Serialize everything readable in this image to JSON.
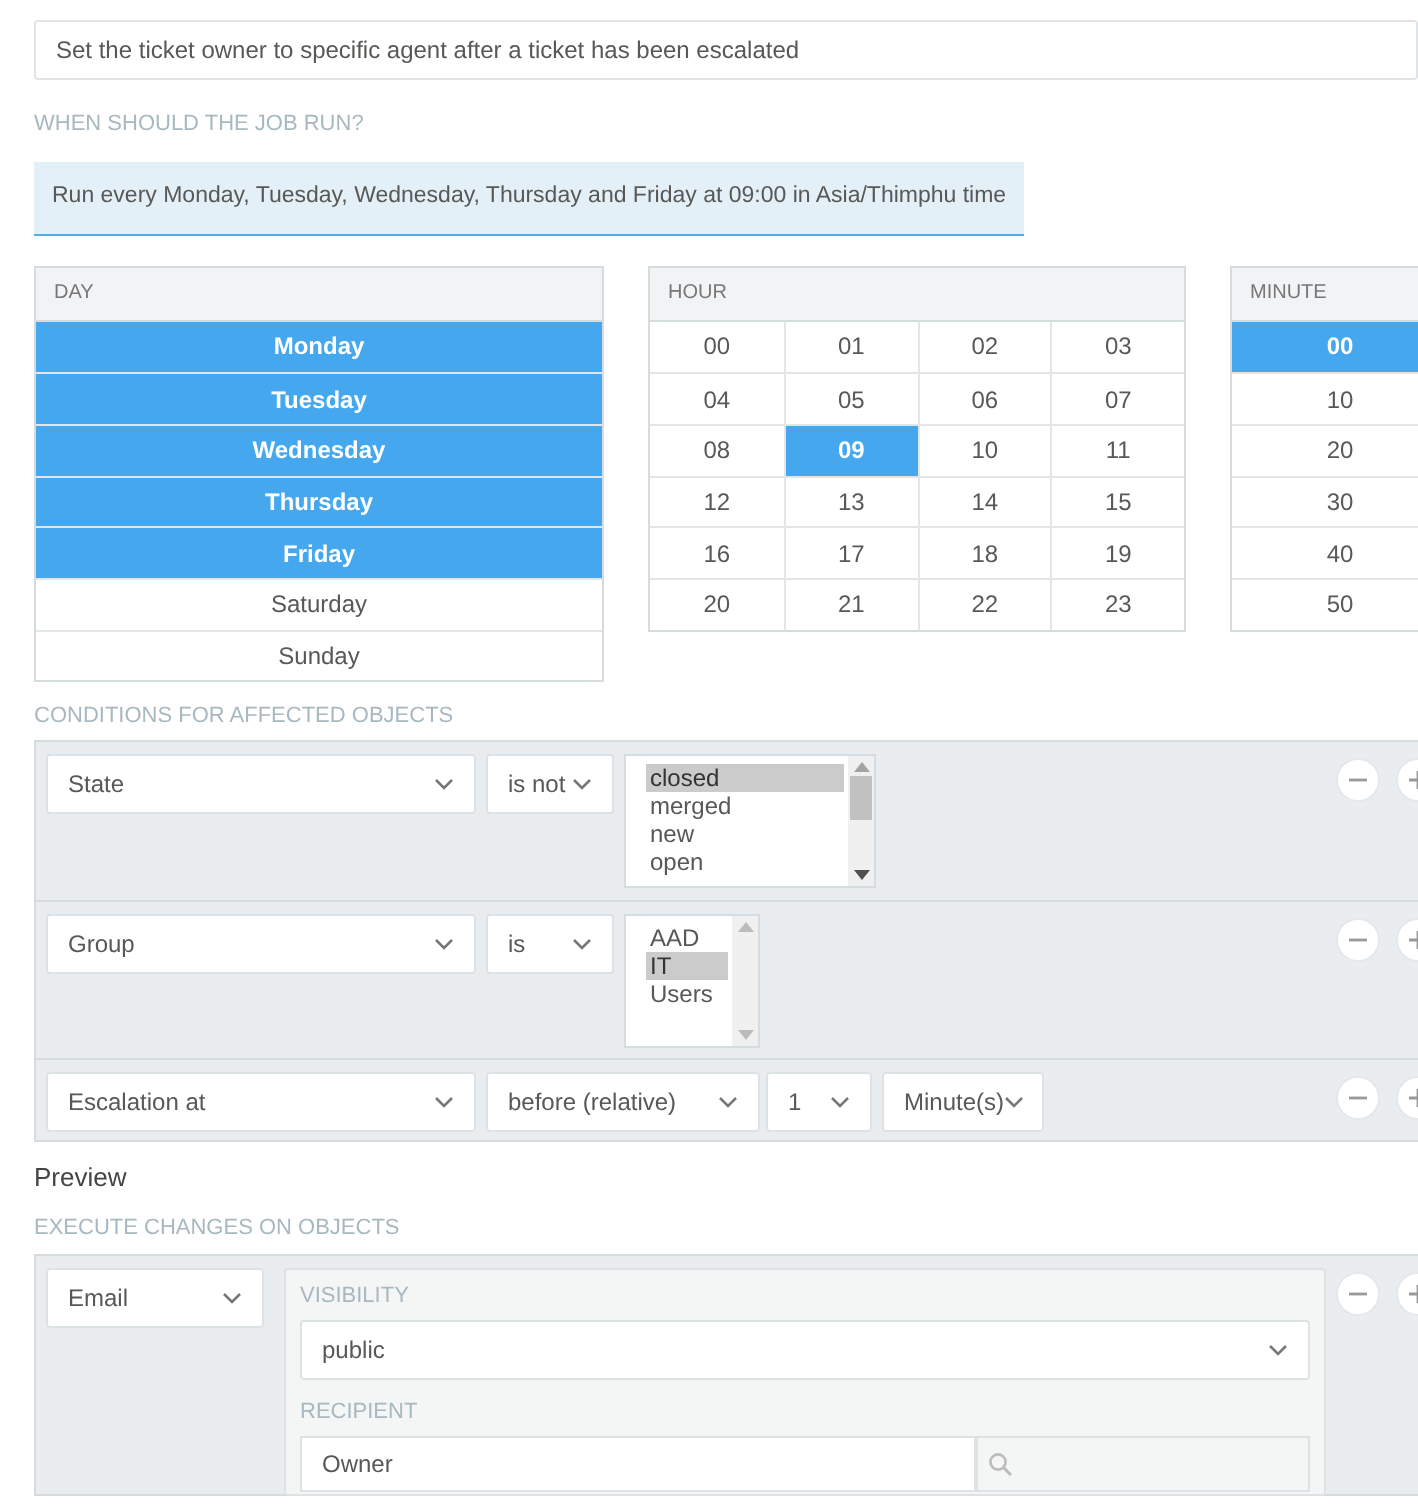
{
  "name_field": {
    "value": "Set the ticket owner to specific agent after a ticket has been escalated"
  },
  "schedule": {
    "label": "WHEN SHOULD THE JOB RUN?",
    "summary": "Run every Monday, Tuesday, Wednesday, Thursday and Friday at 09:00 in Asia/Thimphu time",
    "day": {
      "header": "DAY",
      "items": [
        {
          "label": "Monday",
          "selected": true
        },
        {
          "label": "Tuesday",
          "selected": true
        },
        {
          "label": "Wednesday",
          "selected": true
        },
        {
          "label": "Thursday",
          "selected": true
        },
        {
          "label": "Friday",
          "selected": true
        },
        {
          "label": "Saturday",
          "selected": false
        },
        {
          "label": "Sunday",
          "selected": false
        }
      ]
    },
    "hour": {
      "header": "HOUR",
      "items": [
        {
          "label": "00",
          "selected": false
        },
        {
          "label": "01",
          "selected": false
        },
        {
          "label": "02",
          "selected": false
        },
        {
          "label": "03",
          "selected": false
        },
        {
          "label": "04",
          "selected": false
        },
        {
          "label": "05",
          "selected": false
        },
        {
          "label": "06",
          "selected": false
        },
        {
          "label": "07",
          "selected": false
        },
        {
          "label": "08",
          "selected": false
        },
        {
          "label": "09",
          "selected": true
        },
        {
          "label": "10",
          "selected": false
        },
        {
          "label": "11",
          "selected": false
        },
        {
          "label": "12",
          "selected": false
        },
        {
          "label": "13",
          "selected": false
        },
        {
          "label": "14",
          "selected": false
        },
        {
          "label": "15",
          "selected": false
        },
        {
          "label": "16",
          "selected": false
        },
        {
          "label": "17",
          "selected": false
        },
        {
          "label": "18",
          "selected": false
        },
        {
          "label": "19",
          "selected": false
        },
        {
          "label": "20",
          "selected": false
        },
        {
          "label": "21",
          "selected": false
        },
        {
          "label": "22",
          "selected": false
        },
        {
          "label": "23",
          "selected": false
        }
      ]
    },
    "minute": {
      "header": "MINUTE",
      "items": [
        {
          "label": "00",
          "selected": true
        },
        {
          "label": "10",
          "selected": false
        },
        {
          "label": "20",
          "selected": false
        },
        {
          "label": "30",
          "selected": false
        },
        {
          "label": "40",
          "selected": false
        },
        {
          "label": "50",
          "selected": false
        }
      ]
    }
  },
  "conditions": {
    "label": "CONDITIONS FOR AFFECTED OBJECTS",
    "rows": [
      {
        "kind": "list",
        "attribute": "State",
        "operator": "is not",
        "options": [
          {
            "label": "closed",
            "selected": true
          },
          {
            "label": "merged",
            "selected": false
          },
          {
            "label": "new",
            "selected": false
          },
          {
            "label": "open",
            "selected": false
          }
        ]
      },
      {
        "kind": "list",
        "attribute": "Group",
        "operator": "is",
        "options": [
          {
            "label": "AAD",
            "selected": false
          },
          {
            "label": "IT",
            "selected": true
          },
          {
            "label": "Users",
            "selected": false
          }
        ]
      },
      {
        "kind": "relative",
        "attribute": "Escalation at",
        "operator": "before (relative)",
        "value": "1",
        "unit": "Minute(s)"
      }
    ]
  },
  "preview": "Preview",
  "execute": {
    "label": "EXECUTE CHANGES ON OBJECTS",
    "action": "Email",
    "visibility": {
      "label": "VISIBILITY",
      "value": "public"
    },
    "recipient": {
      "label": "RECIPIENT",
      "value": "Owner"
    }
  }
}
